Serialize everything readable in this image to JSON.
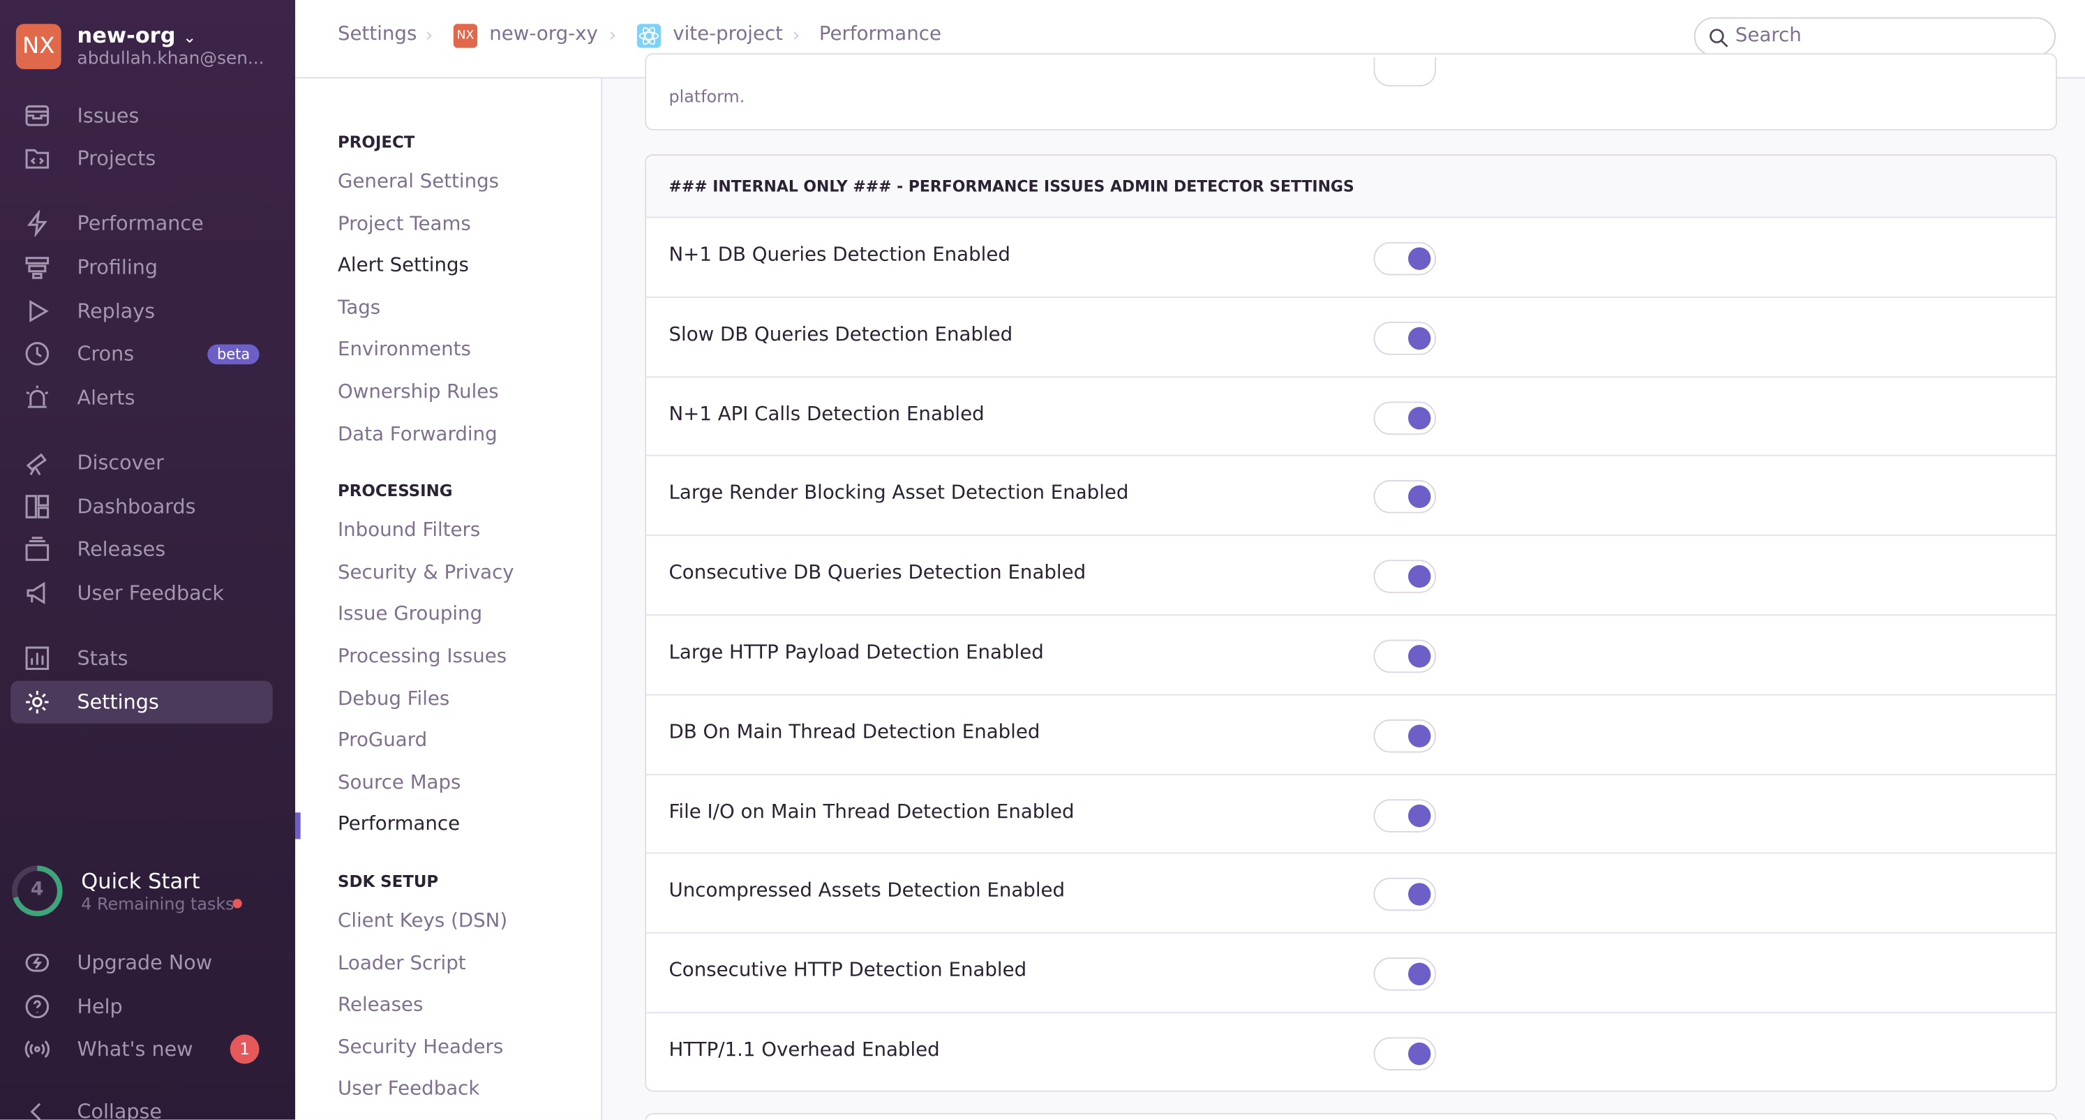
{
  "org": {
    "badge": "NX",
    "name": "new-org",
    "email": "abdullah.khan@sen..."
  },
  "sidebar": {
    "items": [
      {
        "label": "Issues",
        "icon": "issues-icon"
      },
      {
        "label": "Projects",
        "icon": "projects-icon"
      },
      {
        "label": "Performance",
        "icon": "lightning-icon"
      },
      {
        "label": "Profiling",
        "icon": "profiling-icon"
      },
      {
        "label": "Replays",
        "icon": "play-icon"
      },
      {
        "label": "Crons",
        "icon": "clock-icon",
        "badge": "beta"
      },
      {
        "label": "Alerts",
        "icon": "siren-icon"
      },
      {
        "label": "Discover",
        "icon": "telescope-icon"
      },
      {
        "label": "Dashboards",
        "icon": "dashboard-icon"
      },
      {
        "label": "Releases",
        "icon": "releases-icon"
      },
      {
        "label": "User Feedback",
        "icon": "megaphone-icon"
      },
      {
        "label": "Stats",
        "icon": "stats-icon"
      },
      {
        "label": "Settings",
        "icon": "gear-icon",
        "active": true
      }
    ],
    "quick_start": {
      "title": "Quick Start",
      "count": "4",
      "subtitle": "4 Remaining tasks"
    },
    "footer": [
      {
        "label": "Upgrade Now",
        "icon": "upgrade-icon"
      },
      {
        "label": "Help",
        "icon": "help-icon"
      },
      {
        "label": "What's new",
        "icon": "broadcast-icon",
        "badge": "1"
      },
      {
        "label": "Collapse",
        "icon": "chevron-left-icon"
      }
    ]
  },
  "breadcrumb": [
    {
      "label": "Settings"
    },
    {
      "label": "new-org-xy",
      "badge": "NX"
    },
    {
      "label": "vite-project"
    },
    {
      "label": "Performance"
    }
  ],
  "search": {
    "placeholder": "Search"
  },
  "settings_nav": {
    "sections": [
      {
        "title": "PROJECT",
        "items": [
          "General Settings",
          "Project Teams",
          "Alert Settings",
          "Tags",
          "Environments",
          "Ownership Rules",
          "Data Forwarding"
        ]
      },
      {
        "title": "PROCESSING",
        "items": [
          "Inbound Filters",
          "Security & Privacy",
          "Issue Grouping",
          "Processing Issues",
          "Debug Files",
          "ProGuard",
          "Source Maps",
          "Performance"
        ]
      },
      {
        "title": "SDK SETUP",
        "items": [
          "Client Keys (DSN)",
          "Loader Script",
          "Releases",
          "Security Headers",
          "User Feedback"
        ]
      }
    ],
    "current": "Performance"
  },
  "prev_card": {
    "text": "platform."
  },
  "detector_panel": {
    "title": "### INTERNAL ONLY ### - PERFORMANCE ISSUES ADMIN DETECTOR SETTINGS",
    "rows": [
      {
        "label": "N+1 DB Queries Detection Enabled",
        "enabled": true
      },
      {
        "label": "Slow DB Queries Detection Enabled",
        "enabled": true
      },
      {
        "label": "N+1 API Calls Detection Enabled",
        "enabled": true
      },
      {
        "label": "Large Render Blocking Asset Detection Enabled",
        "enabled": true
      },
      {
        "label": "Consecutive DB Queries Detection Enabled",
        "enabled": true
      },
      {
        "label": "Large HTTP Payload Detection Enabled",
        "enabled": true
      },
      {
        "label": "DB On Main Thread Detection Enabled",
        "enabled": true
      },
      {
        "label": "File I/O on Main Thread Detection Enabled",
        "enabled": true
      },
      {
        "label": "Uncompressed Assets Detection Enabled",
        "enabled": true
      },
      {
        "label": "Consecutive HTTP Detection Enabled",
        "enabled": true
      },
      {
        "label": "HTTP/1.1 Overhead Enabled",
        "enabled": true
      }
    ]
  },
  "colors": {
    "accent": "#6c5fc7",
    "org_badge": "#e0684b",
    "sidebar": "#34213f",
    "progress": "#3fa37c",
    "alert": "#e5595a"
  }
}
